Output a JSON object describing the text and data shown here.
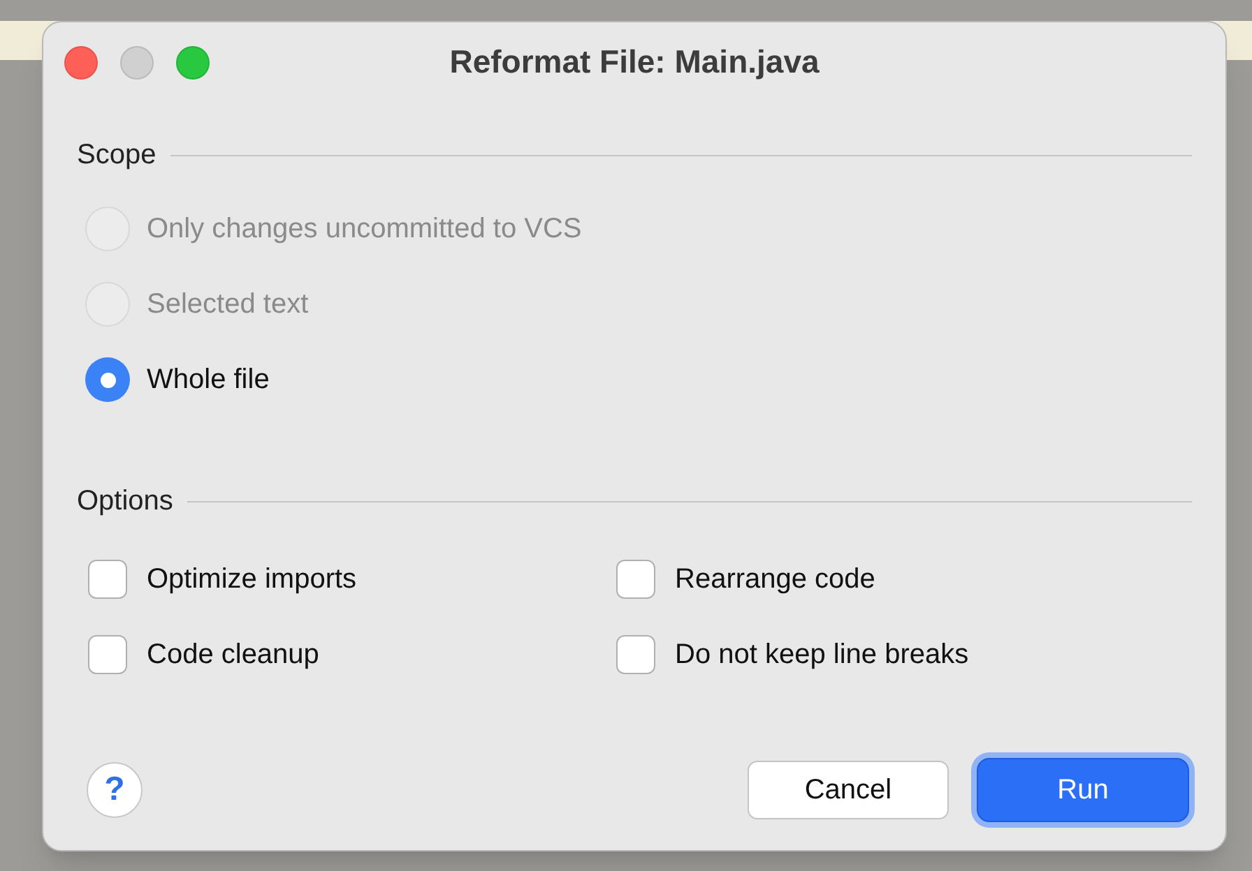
{
  "window": {
    "title": "Reformat File: Main.java",
    "controls": [
      {
        "kind": "close",
        "disabled": false
      },
      {
        "kind": "minimize",
        "disabled": true
      },
      {
        "kind": "maximize",
        "disabled": false
      }
    ]
  },
  "scope": {
    "heading": "Scope",
    "options": [
      {
        "label": "Only changes uncommitted to VCS",
        "selected": false,
        "disabled": true
      },
      {
        "label": "Selected text",
        "selected": false,
        "disabled": true
      },
      {
        "label": "Whole file",
        "selected": true,
        "disabled": false
      }
    ]
  },
  "options": {
    "heading": "Options",
    "items": [
      {
        "label": "Optimize imports",
        "checked": false
      },
      {
        "label": "Rearrange code",
        "checked": false
      },
      {
        "label": "Code cleanup",
        "checked": false
      },
      {
        "label": "Do not keep line breaks",
        "checked": false
      }
    ]
  },
  "help": {
    "label": "?"
  },
  "buttons": [
    {
      "label": "Cancel",
      "default": false
    },
    {
      "label": "Run",
      "default": true
    }
  ]
}
